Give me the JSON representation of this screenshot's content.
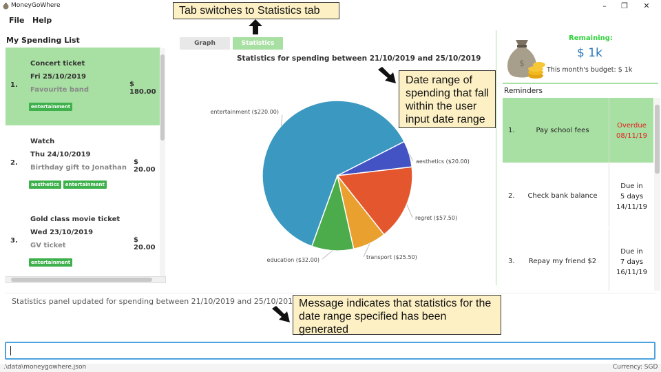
{
  "window": {
    "title": "MoneyGoWhere",
    "min_glyph": "–",
    "max_glyph": "❐",
    "close_glyph": "✕"
  },
  "menu": {
    "items": [
      "File",
      "Help"
    ]
  },
  "spending": {
    "title": "My Spending List",
    "items": [
      {
        "index": "1.",
        "name": "Concert ticket",
        "date": "Fri 25/10/2019",
        "remark": "Favourite band",
        "amount": "$ 180.00",
        "tags": [
          "entertainment"
        ],
        "selected": true
      },
      {
        "index": "2.",
        "name": "Watch",
        "date": "Thu 24/10/2019",
        "remark": "Birthday gift to Jonathan",
        "amount": "$ 20.00",
        "tags": [
          "aesthetics",
          "entertainment"
        ],
        "selected": false
      },
      {
        "index": "3.",
        "name": "Gold class movie ticket",
        "date": "Wed 23/10/2019",
        "remark": "GV ticket",
        "amount": "$ 20.00",
        "tags": [
          "entertainment"
        ],
        "selected": false
      }
    ]
  },
  "tabs": {
    "graph": "Graph",
    "statistics": "Statistics",
    "active": "statistics"
  },
  "statistics": {
    "title": "Statistics for spending between 21/10/2019 and 25/10/2019"
  },
  "chart_data": {
    "type": "pie",
    "title": "Statistics for spending between 21/10/2019 and 25/10/2019",
    "slices": [
      {
        "label": "entertainment ($220.00)",
        "value": 220.0,
        "color": "#3b98c0"
      },
      {
        "label": "aesthetics ($20.00)",
        "value": 20.0,
        "color": "#4453c4"
      },
      {
        "label": "regret ($57.50)",
        "value": 57.5,
        "color": "#e4562e"
      },
      {
        "label": "transport ($25.50)",
        "value": 25.5,
        "color": "#e9a02e"
      },
      {
        "label": "education ($32.00)",
        "value": 32.0,
        "color": "#4cac4c"
      }
    ]
  },
  "budget": {
    "remaining_label": "Remaining:",
    "remaining_value": "$ 1k",
    "budget_text": "This month's budget: $ 1k"
  },
  "reminders": {
    "title": "Reminders",
    "rows": [
      {
        "index": "1.",
        "description": "Pay school fees",
        "status_lines": [
          "Overdue",
          "08/11/19"
        ],
        "overdue": true
      },
      {
        "index": "2.",
        "description": "Check bank balance",
        "status_lines": [
          "Due in",
          "5 days",
          "14/11/19"
        ],
        "overdue": false
      },
      {
        "index": "3.",
        "description": "Repay my friend $2",
        "status_lines": [
          "Due in",
          "7 days",
          "16/11/19"
        ],
        "overdue": false
      }
    ]
  },
  "result": {
    "text": "Statistics panel updated for spending between 21/10/2019 and 25/10/2019!"
  },
  "command": {
    "value": ""
  },
  "status": {
    "path": ".\\data\\moneygowhere.json",
    "currency": "Currency: SGD"
  },
  "annotations": {
    "tab_note": "Tab switches to Statistics tab",
    "date_note": [
      "Date range of",
      "spending that fall",
      "within the user",
      "input date range"
    ],
    "msg_note": [
      "Message indicates that statistics for the",
      "date range specified has been",
      "generated"
    ]
  },
  "colors": {
    "accent_green": "#a8dfa2",
    "tag_green": "#3eb14c",
    "overdue_red": "#e02020",
    "remaining_green": "#2fd13a",
    "value_blue": "#2c78b8",
    "command_border": "#4aa3df"
  }
}
